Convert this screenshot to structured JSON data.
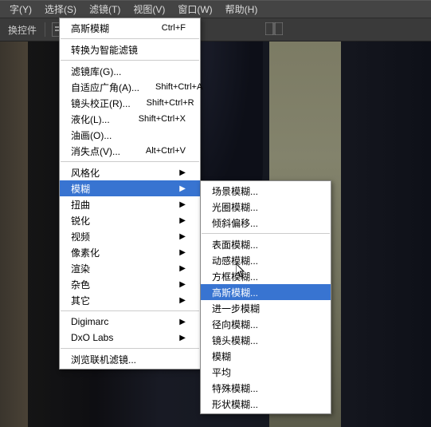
{
  "menubar": {
    "items": [
      {
        "label": "字(Y)"
      },
      {
        "label": "选择(S)"
      },
      {
        "label": "滤镜(T)"
      },
      {
        "label": "视图(V)"
      },
      {
        "label": "窗口(W)"
      },
      {
        "label": "帮助(H)"
      }
    ]
  },
  "toolbar": {
    "label": "换控件"
  },
  "filter_menu": {
    "last": {
      "label": "高斯模糊",
      "shortcut": "Ctrl+F"
    },
    "convert_smart": "转换为智能滤镜",
    "groups": [
      [
        {
          "label": "滤镜库(G)...",
          "shortcut": ""
        },
        {
          "label": "自适应广角(A)...",
          "shortcut": "Shift+Ctrl+A"
        },
        {
          "label": "镜头校正(R)...",
          "shortcut": "Shift+Ctrl+R"
        },
        {
          "label": "液化(L)...",
          "shortcut": "Shift+Ctrl+X"
        },
        {
          "label": "油画(O)...",
          "shortcut": ""
        },
        {
          "label": "消失点(V)...",
          "shortcut": "Alt+Ctrl+V"
        }
      ],
      [
        {
          "label": "风格化",
          "sub": true
        },
        {
          "label": "模糊",
          "sub": true,
          "hl": true
        },
        {
          "label": "扭曲",
          "sub": true
        },
        {
          "label": "锐化",
          "sub": true
        },
        {
          "label": "视频",
          "sub": true
        },
        {
          "label": "像素化",
          "sub": true
        },
        {
          "label": "渲染",
          "sub": true
        },
        {
          "label": "杂色",
          "sub": true
        },
        {
          "label": "其它",
          "sub": true
        }
      ],
      [
        {
          "label": "Digimarc",
          "sub": true
        },
        {
          "label": "DxO Labs",
          "sub": true
        }
      ],
      [
        {
          "label": "浏览联机滤镜..."
        }
      ]
    ]
  },
  "blur_submenu": {
    "groups": [
      [
        {
          "label": "场景模糊..."
        },
        {
          "label": "光圈模糊..."
        },
        {
          "label": "倾斜偏移..."
        }
      ],
      [
        {
          "label": "表面模糊..."
        },
        {
          "label": "动感模糊..."
        },
        {
          "label": "方框模糊..."
        },
        {
          "label": "高斯模糊...",
          "hl": true
        },
        {
          "label": "进一步模糊"
        },
        {
          "label": "径向模糊..."
        },
        {
          "label": "镜头模糊..."
        },
        {
          "label": "模糊"
        },
        {
          "label": "平均"
        },
        {
          "label": "特殊模糊..."
        },
        {
          "label": "形状模糊..."
        }
      ]
    ]
  }
}
